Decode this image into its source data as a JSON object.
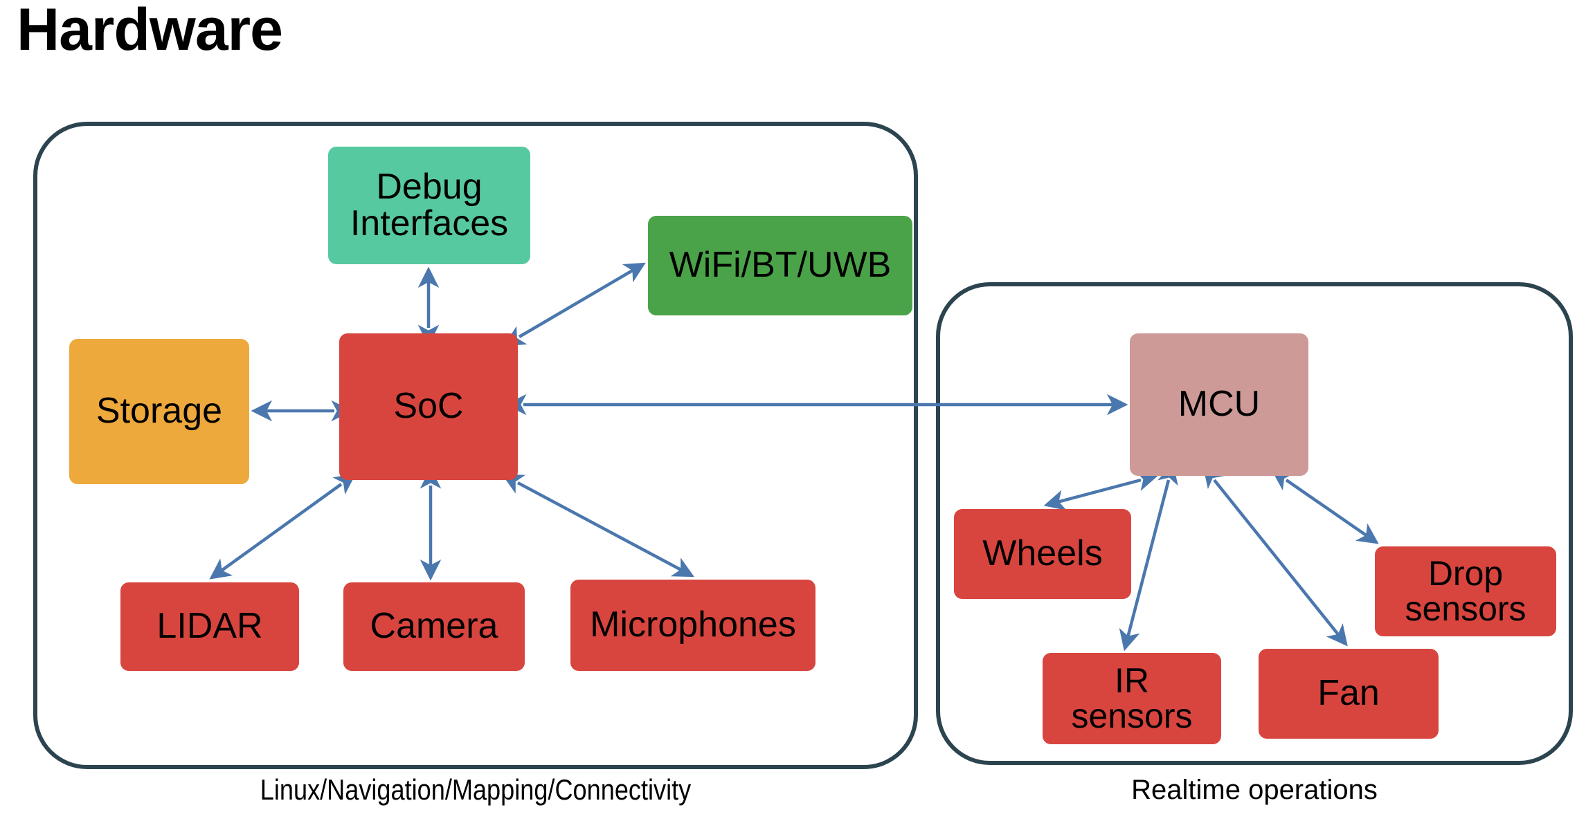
{
  "title": "Hardware",
  "colors": {
    "container_border": "#2c444f",
    "red": "#d8453f",
    "teal": "#57c9a0",
    "green": "#4ba349",
    "amber": "#eda93c",
    "rose": "#cd9a97",
    "arrow": "#4a77ad",
    "text": "#000000",
    "background": "#ffffff"
  },
  "groups": {
    "left": {
      "caption": "Linux/Navigation/Mapping/Connectivity"
    },
    "right": {
      "caption": "Realtime operations"
    }
  },
  "nodes": {
    "debug": {
      "label": "Debug\nInterfaces",
      "line1": "Debug",
      "line2": "Interfaces",
      "color": "#57c9a0"
    },
    "wifi": {
      "label": "WiFi/BT/UWB",
      "color": "#4ba349"
    },
    "storage": {
      "label": "Storage",
      "color": "#eda93c"
    },
    "soc": {
      "label": "SoC",
      "color": "#d8453f"
    },
    "lidar": {
      "label": "LIDAR",
      "color": "#d8453f"
    },
    "camera": {
      "label": "Camera",
      "color": "#d8453f"
    },
    "microphones": {
      "label": "Microphones",
      "color": "#d8453f"
    },
    "mcu": {
      "label": "MCU",
      "color": "#cd9a97"
    },
    "wheels": {
      "label": "Wheels",
      "color": "#d8453f"
    },
    "ir_sensors": {
      "label": "IR\nsensors",
      "line1": "IR",
      "line2": "sensors",
      "color": "#d8453f"
    },
    "fan": {
      "label": "Fan",
      "color": "#d8453f"
    },
    "drop_sensors": {
      "label": "Drop\nsensors",
      "line1": "Drop",
      "line2": "sensors",
      "color": "#d8453f"
    }
  },
  "edges": [
    {
      "from": "soc",
      "to": "debug",
      "arrows": "both"
    },
    {
      "from": "soc",
      "to": "wifi",
      "arrows": "both"
    },
    {
      "from": "soc",
      "to": "storage",
      "arrows": "both"
    },
    {
      "from": "soc",
      "to": "lidar",
      "arrows": "both"
    },
    {
      "from": "soc",
      "to": "camera",
      "arrows": "both"
    },
    {
      "from": "soc",
      "to": "microphones",
      "arrows": "both"
    },
    {
      "from": "soc",
      "to": "mcu",
      "arrows": "both"
    },
    {
      "from": "mcu",
      "to": "wheels",
      "arrows": "both"
    },
    {
      "from": "mcu",
      "to": "ir_sensors",
      "arrows": "both"
    },
    {
      "from": "mcu",
      "to": "fan",
      "arrows": "both"
    },
    {
      "from": "mcu",
      "to": "drop_sensors",
      "arrows": "both"
    }
  ]
}
